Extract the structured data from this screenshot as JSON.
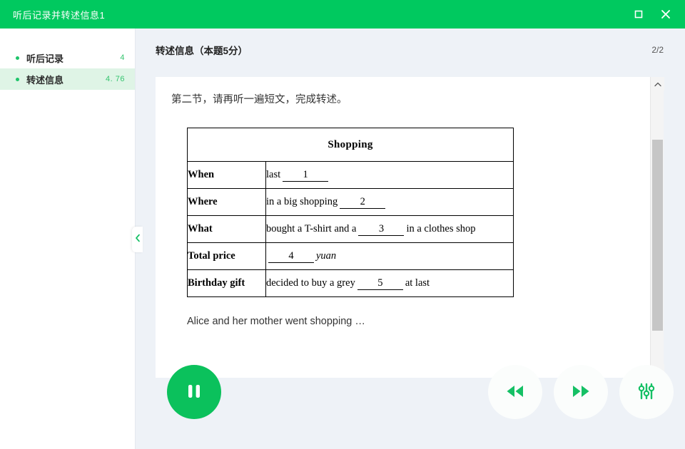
{
  "window": {
    "title": "听后记录并转述信息1",
    "maximize_label": "maximize",
    "close_label": "close"
  },
  "sidebar": {
    "items": [
      {
        "label": "听后记录",
        "score": "4",
        "active": false
      },
      {
        "label": "转述信息",
        "score": "4. 76",
        "active": true
      }
    ],
    "collapse_label": "collapse-sidebar"
  },
  "main": {
    "title": "转述信息（本题5分）",
    "page_indicator": "2/2",
    "intro": "第二节，请再听一遍短文，完成转述。",
    "closing": "Alice and her mother went shopping …"
  },
  "table": {
    "heading": "Shopping",
    "rows": [
      {
        "key": "When",
        "pre": "last",
        "blank": "1",
        "post": ""
      },
      {
        "key": "Where",
        "pre": "in a big shopping",
        "blank": "2",
        "post": ""
      },
      {
        "key": "What",
        "pre": "bought a T-shirt and a",
        "blank": "3",
        "post": "in a clothes shop"
      },
      {
        "key": "Total price",
        "pre": "",
        "blank": "4",
        "post": "yuan"
      },
      {
        "key": "Birthday gift",
        "pre": "decided to buy a grey",
        "blank": "5",
        "post": "at last"
      }
    ]
  },
  "controls": {
    "play_label": "pause",
    "rewind_label": "rewind",
    "forward_label": "fast-forward",
    "settings_label": "audio-settings"
  },
  "colors": {
    "brand_green": "#00c95f",
    "button_green": "#0bc15c",
    "icon_green": "#15c065",
    "active_row": "#dff4e6",
    "page_bg": "#eef2f7"
  }
}
